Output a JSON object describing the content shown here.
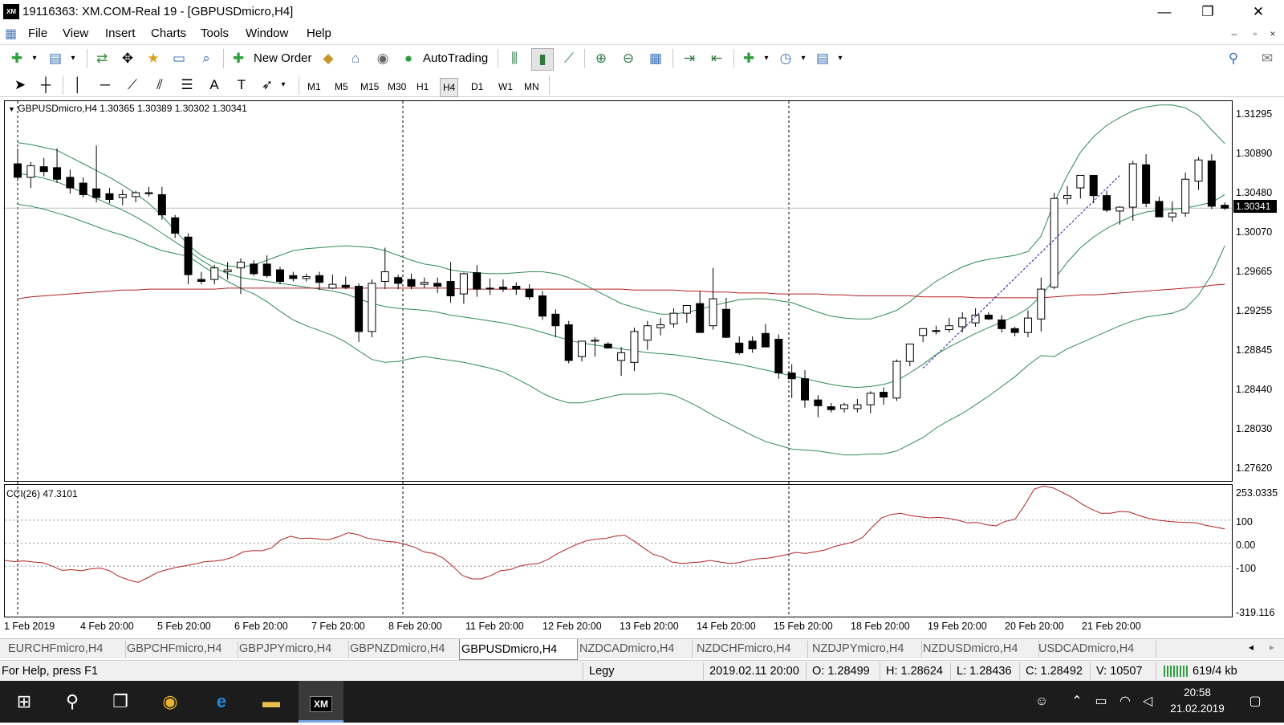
{
  "window": {
    "logo": "XM",
    "title": "19116363: XM.COM-Real 19 - [GBPUSDmicro,H4]",
    "minimize": "—",
    "maximize": "❐",
    "close": "✕"
  },
  "menu": {
    "items": [
      "File",
      "View",
      "Insert",
      "Charts",
      "Tools",
      "Window",
      "Help"
    ],
    "mdi": [
      "–",
      "▫",
      "×"
    ]
  },
  "toolbar1": {
    "new_order_label": "New Order",
    "autotrading_label": "AutoTrading"
  },
  "toolbar2": {
    "timeframes": [
      "M1",
      "M5",
      "M15",
      "M30",
      "H1",
      "H4",
      "D1",
      "W1",
      "MN"
    ],
    "active_timeframe": "H4"
  },
  "chart": {
    "info": "GBPUSDmicro,H4  1.30365 1.30389 1.30302 1.30341",
    "indicator_info": "CCI(26) 47.3101",
    "current_price": "1.30341",
    "colors": {
      "candle_bear": "#000000",
      "candle_bull": "#ffffff",
      "bands": "#2e8b57",
      "ma": "#b22222",
      "cci": "#b22222"
    }
  },
  "chart_data": {
    "type": "candlestick",
    "symbol": "GBPUSDmicro",
    "timeframe": "H4",
    "price_axis_labels": [
      "1.31295",
      "1.30890",
      "1.30480",
      "1.30070",
      "1.29665",
      "1.29255",
      "1.28845",
      "1.28440",
      "1.28030",
      "1.27620"
    ],
    "ylim": [
      1.2751,
      1.3145
    ],
    "cci_axis_labels": [
      "253.0335",
      "100",
      "0.00",
      "-100",
      "-319.116"
    ],
    "cci_ylim": [
      -319.116,
      253.0335
    ],
    "date_labels": [
      "1 Feb 2019",
      "4 Feb 20:00",
      "5 Feb 20:00",
      "6 Feb 20:00",
      "7 Feb 20:00",
      "8 Feb 20:00",
      "11 Feb 20:00",
      "12 Feb 20:00",
      "13 Feb 20:00",
      "14 Feb 20:00",
      "15 Feb 20:00",
      "18 Feb 20:00",
      "19 Feb 20:00",
      "20 Feb 20:00",
      "21 Feb 20:00"
    ],
    "candles": [
      {
        "o": 1.308,
        "h": 1.3096,
        "l": 1.3062,
        "c": 1.3066
      },
      {
        "o": 1.3066,
        "h": 1.3082,
        "l": 1.3055,
        "c": 1.3078
      },
      {
        "o": 1.3077,
        "h": 1.3086,
        "l": 1.3067,
        "c": 1.3072
      },
      {
        "o": 1.3076,
        "h": 1.3096,
        "l": 1.306,
        "c": 1.3064
      },
      {
        "o": 1.3066,
        "h": 1.3074,
        "l": 1.3049,
        "c": 1.3055
      },
      {
        "o": 1.306,
        "h": 1.3066,
        "l": 1.3045,
        "c": 1.3048
      },
      {
        "o": 1.3054,
        "h": 1.3099,
        "l": 1.304,
        "c": 1.3045
      },
      {
        "o": 1.3049,
        "h": 1.3055,
        "l": 1.3039,
        "c": 1.3043
      },
      {
        "o": 1.3045,
        "h": 1.3053,
        "l": 1.3037,
        "c": 1.3048
      },
      {
        "o": 1.3046,
        "h": 1.3052,
        "l": 1.304,
        "c": 1.305
      },
      {
        "o": 1.305,
        "h": 1.3056,
        "l": 1.3046,
        "c": 1.3049
      },
      {
        "o": 1.3048,
        "h": 1.3056,
        "l": 1.3022,
        "c": 1.3027
      },
      {
        "o": 1.3024,
        "h": 1.3027,
        "l": 1.3003,
        "c": 1.3008
      },
      {
        "o": 1.3004,
        "h": 1.3008,
        "l": 1.2955,
        "c": 1.2965
      },
      {
        "o": 1.296,
        "h": 1.2968,
        "l": 1.2955,
        "c": 1.2958
      },
      {
        "o": 1.296,
        "h": 1.2975,
        "l": 1.2955,
        "c": 1.2972
      },
      {
        "o": 1.2968,
        "h": 1.2978,
        "l": 1.296,
        "c": 1.297
      },
      {
        "o": 1.2972,
        "h": 1.2982,
        "l": 1.2945,
        "c": 1.2978
      },
      {
        "o": 1.2976,
        "h": 1.298,
        "l": 1.2964,
        "c": 1.2966
      },
      {
        "o": 1.2976,
        "h": 1.2985,
        "l": 1.2962,
        "c": 1.2964
      },
      {
        "o": 1.297,
        "h": 1.2973,
        "l": 1.2955,
        "c": 1.2958
      },
      {
        "o": 1.2964,
        "h": 1.2968,
        "l": 1.2958,
        "c": 1.2961
      },
      {
        "o": 1.2961,
        "h": 1.2966,
        "l": 1.2958,
        "c": 1.2963
      },
      {
        "o": 1.2964,
        "h": 1.2968,
        "l": 1.2949,
        "c": 1.2957
      },
      {
        "o": 1.2951,
        "h": 1.2965,
        "l": 1.295,
        "c": 1.2955
      },
      {
        "o": 1.2954,
        "h": 1.2963,
        "l": 1.295,
        "c": 1.2952
      },
      {
        "o": 1.2953,
        "h": 1.2956,
        "l": 1.2895,
        "c": 1.2906
      },
      {
        "o": 1.2906,
        "h": 1.296,
        "l": 1.29,
        "c": 1.2956
      },
      {
        "o": 1.2958,
        "h": 1.2993,
        "l": 1.295,
        "c": 1.2968
      },
      {
        "o": 1.2962,
        "h": 1.2965,
        "l": 1.295,
        "c": 1.2956
      },
      {
        "o": 1.296,
        "h": 1.2966,
        "l": 1.295,
        "c": 1.2953
      },
      {
        "o": 1.2955,
        "h": 1.2962,
        "l": 1.2951,
        "c": 1.2957
      },
      {
        "o": 1.2956,
        "h": 1.2962,
        "l": 1.2946,
        "c": 1.2953
      },
      {
        "o": 1.2958,
        "h": 1.2978,
        "l": 1.2936,
        "c": 1.2943
      },
      {
        "o": 1.2945,
        "h": 1.2967,
        "l": 1.2935,
        "c": 1.2966
      },
      {
        "o": 1.2967,
        "h": 1.2975,
        "l": 1.2942,
        "c": 1.295
      },
      {
        "o": 1.2951,
        "h": 1.2961,
        "l": 1.2944,
        "c": 1.2951
      },
      {
        "o": 1.2952,
        "h": 1.296,
        "l": 1.2947,
        "c": 1.295
      },
      {
        "o": 1.2953,
        "h": 1.2957,
        "l": 1.2944,
        "c": 1.295
      },
      {
        "o": 1.295,
        "h": 1.2955,
        "l": 1.2939,
        "c": 1.2942
      },
      {
        "o": 1.2943,
        "h": 1.2948,
        "l": 1.2918,
        "c": 1.2922
      },
      {
        "o": 1.2924,
        "h": 1.2929,
        "l": 1.29,
        "c": 1.2912
      },
      {
        "o": 1.2913,
        "h": 1.2917,
        "l": 1.2873,
        "c": 1.2876
      },
      {
        "o": 1.288,
        "h": 1.2895,
        "l": 1.2875,
        "c": 1.2896
      },
      {
        "o": 1.2896,
        "h": 1.29,
        "l": 1.288,
        "c": 1.2897
      },
      {
        "o": 1.2893,
        "h": 1.2895,
        "l": 1.2888,
        "c": 1.2889
      },
      {
        "o": 1.2876,
        "h": 1.289,
        "l": 1.286,
        "c": 1.2884
      },
      {
        "o": 1.2874,
        "h": 1.291,
        "l": 1.2865,
        "c": 1.2906
      },
      {
        "o": 1.2897,
        "h": 1.2917,
        "l": 1.2887,
        "c": 1.2912
      },
      {
        "o": 1.291,
        "h": 1.292,
        "l": 1.2902,
        "c": 1.2913
      },
      {
        "o": 1.2914,
        "h": 1.293,
        "l": 1.291,
        "c": 1.2925
      },
      {
        "o": 1.2925,
        "h": 1.2931,
        "l": 1.2915,
        "c": 1.2933
      },
      {
        "o": 1.2935,
        "h": 1.2948,
        "l": 1.2905,
        "c": 1.2905
      },
      {
        "o": 1.2912,
        "h": 1.2972,
        "l": 1.2908,
        "c": 1.294
      },
      {
        "o": 1.2929,
        "h": 1.2941,
        "l": 1.2899,
        "c": 1.29
      },
      {
        "o": 1.2894,
        "h": 1.2901,
        "l": 1.2882,
        "c": 1.2884
      },
      {
        "o": 1.2896,
        "h": 1.2901,
        "l": 1.2884,
        "c": 1.2888
      },
      {
        "o": 1.2904,
        "h": 1.2914,
        "l": 1.2896,
        "c": 1.289
      },
      {
        "o": 1.2898,
        "h": 1.2903,
        "l": 1.2857,
        "c": 1.2863
      },
      {
        "o": 1.2863,
        "h": 1.2872,
        "l": 1.2837,
        "c": 1.2857
      },
      {
        "o": 1.2857,
        "h": 1.2866,
        "l": 1.2827,
        "c": 1.2835
      },
      {
        "o": 1.2835,
        "h": 1.284,
        "l": 1.2817,
        "c": 1.2829
      },
      {
        "o": 1.2828,
        "h": 1.2832,
        "l": 1.2822,
        "c": 1.2825
      },
      {
        "o": 1.2826,
        "h": 1.2832,
        "l": 1.2822,
        "c": 1.283
      },
      {
        "o": 1.2826,
        "h": 1.2836,
        "l": 1.2822,
        "c": 1.283
      },
      {
        "o": 1.283,
        "h": 1.2844,
        "l": 1.2821,
        "c": 1.2842
      },
      {
        "o": 1.2843,
        "h": 1.2848,
        "l": 1.283,
        "c": 1.2838
      },
      {
        "o": 1.2837,
        "h": 1.2877,
        "l": 1.2834,
        "c": 1.2875
      },
      {
        "o": 1.2875,
        "h": 1.2892,
        "l": 1.287,
        "c": 1.2893
      },
      {
        "o": 1.2902,
        "h": 1.2907,
        "l": 1.2895,
        "c": 1.2909
      },
      {
        "o": 1.2907,
        "h": 1.2912,
        "l": 1.2903,
        "c": 1.2906
      },
      {
        "o": 1.2908,
        "h": 1.292,
        "l": 1.2905,
        "c": 1.2912
      },
      {
        "o": 1.2911,
        "h": 1.2926,
        "l": 1.2905,
        "c": 1.292
      },
      {
        "o": 1.2915,
        "h": 1.293,
        "l": 1.2911,
        "c": 1.2923
      },
      {
        "o": 1.2923,
        "h": 1.2926,
        "l": 1.2918,
        "c": 1.2919
      },
      {
        "o": 1.2918,
        "h": 1.2923,
        "l": 1.2905,
        "c": 1.2909
      },
      {
        "o": 1.2909,
        "h": 1.2911,
        "l": 1.2901,
        "c": 1.2905
      },
      {
        "o": 1.2905,
        "h": 1.2928,
        "l": 1.29,
        "c": 1.292
      },
      {
        "o": 1.2919,
        "h": 1.2962,
        "l": 1.2906,
        "c": 1.295
      },
      {
        "o": 1.2952,
        "h": 1.305,
        "l": 1.295,
        "c": 1.3044
      },
      {
        "o": 1.3044,
        "h": 1.3057,
        "l": 1.3038,
        "c": 1.3047
      },
      {
        "o": 1.3055,
        "h": 1.3063,
        "l": 1.3044,
        "c": 1.3068
      },
      {
        "o": 1.3068,
        "h": 1.3066,
        "l": 1.3039,
        "c": 1.3047
      },
      {
        "o": 1.3047,
        "h": 1.3052,
        "l": 1.303,
        "c": 1.3032
      },
      {
        "o": 1.3031,
        "h": 1.3036,
        "l": 1.3017,
        "c": 1.3035
      },
      {
        "o": 1.3035,
        "h": 1.3083,
        "l": 1.3021,
        "c": 1.308
      },
      {
        "o": 1.3079,
        "h": 1.309,
        "l": 1.3035,
        "c": 1.3039
      },
      {
        "o": 1.3041,
        "h": 1.3046,
        "l": 1.3028,
        "c": 1.3025
      },
      {
        "o": 1.3025,
        "h": 1.3041,
        "l": 1.302,
        "c": 1.3029
      },
      {
        "o": 1.3029,
        "h": 1.3071,
        "l": 1.3025,
        "c": 1.3064
      },
      {
        "o": 1.3062,
        "h": 1.3087,
        "l": 1.3053,
        "c": 1.3084
      },
      {
        "o": 1.3083,
        "h": 1.309,
        "l": 1.3033,
        "c": 1.3036
      },
      {
        "o": 1.3037,
        "h": 1.304,
        "l": 1.3032,
        "c": 1.3034
      }
    ],
    "upper_band": [
      1.3102,
      1.31,
      1.3097,
      1.3094,
      1.3087,
      1.308,
      1.3073,
      1.3066,
      1.3058,
      1.3049,
      1.3039,
      1.3026,
      1.3011,
      1.2996,
      1.2985,
      1.2978,
      1.2974,
      1.2973,
      1.2975,
      1.298,
      1.2985,
      1.299,
      1.2992,
      1.2993,
      1.2994,
      1.2995,
      1.2994,
      1.2993,
      1.299,
      1.2985,
      1.298,
      1.2976,
      1.2974,
      1.297,
      1.2968,
      1.2967,
      1.2966,
      1.2966,
      1.2967,
      1.2968,
      1.2968,
      1.2966,
      1.2962,
      1.2956,
      1.2949,
      1.2942,
      1.2935,
      1.2931,
      1.2927,
      1.2924,
      1.2924,
      1.2926,
      1.2929,
      1.2933,
      1.2936,
      1.2939,
      1.294,
      1.294,
      1.2938,
      1.2936,
      1.2931,
      1.2926,
      1.2922,
      1.292,
      1.2919,
      1.2919,
      1.2923,
      1.2928,
      1.2937,
      1.2948,
      1.2958,
      1.2966,
      1.2973,
      1.2978,
      1.2981,
      1.2983,
      1.2985,
      1.2989,
      1.3005,
      1.304,
      1.3068,
      1.3092,
      1.3108,
      1.312,
      1.3128,
      1.3135,
      1.3139,
      1.3141,
      1.3141,
      1.3138,
      1.313,
      1.3115,
      1.3101
    ],
    "middle_band": [
      1.307,
      1.3068,
      1.3065,
      1.3061,
      1.3056,
      1.305,
      1.3044,
      1.3038,
      1.3032,
      1.3025,
      1.3017,
      1.3008,
      1.2999,
      1.299,
      1.298,
      1.2972,
      1.2966,
      1.2962,
      1.296,
      1.2958,
      1.2956,
      1.2954,
      1.2952,
      1.295,
      1.2948,
      1.2945,
      1.294,
      1.2935,
      1.2932,
      1.293,
      1.2929,
      1.2928,
      1.2926,
      1.2923,
      1.2921,
      1.2919,
      1.2917,
      1.2915,
      1.2912,
      1.2909,
      1.2905,
      1.2901,
      1.2897,
      1.2894,
      1.2892,
      1.289,
      1.2888,
      1.2886,
      1.2884,
      1.2883,
      1.2882,
      1.288,
      1.2878,
      1.2876,
      1.2874,
      1.2872,
      1.2869,
      1.2866,
      1.2863,
      1.286,
      1.2857,
      1.2854,
      1.2851,
      1.2849,
      1.2848,
      1.2849,
      1.2851,
      1.2855,
      1.2863,
      1.2872,
      1.2882,
      1.289,
      1.2897,
      1.2904,
      1.291,
      1.2916,
      1.2922,
      1.293,
      1.2943,
      1.296,
      1.2978,
      1.2993,
      1.3004,
      1.3013,
      1.302,
      1.3026,
      1.303,
      1.3032,
      1.3033,
      1.3034,
      1.3037,
      1.304,
      1.3048
    ],
    "lower_band": [
      1.3038,
      1.3036,
      1.3033,
      1.3029,
      1.3025,
      1.302,
      1.3015,
      1.301,
      1.3006,
      1.3001,
      1.2995,
      1.299,
      1.2987,
      1.2984,
      1.2975,
      1.2966,
      1.2958,
      1.2951,
      1.2945,
      1.2937,
      1.2927,
      1.2918,
      1.2912,
      1.2907,
      1.2902,
      1.2895,
      1.2886,
      1.2877,
      1.2874,
      1.2875,
      1.2878,
      1.288,
      1.2878,
      1.2876,
      1.2874,
      1.2871,
      1.2868,
      1.2864,
      1.2857,
      1.285,
      1.2842,
      1.2836,
      1.2832,
      1.2832,
      1.2835,
      1.2838,
      1.2841,
      1.2841,
      1.2841,
      1.2842,
      1.284,
      1.2834,
      1.2827,
      1.2819,
      1.2812,
      1.2805,
      1.2798,
      1.2792,
      1.2788,
      1.2784,
      1.2783,
      1.2782,
      1.278,
      1.2778,
      1.2778,
      1.2779,
      1.2779,
      1.2782,
      1.2789,
      1.2796,
      1.2806,
      1.2814,
      1.2821,
      1.283,
      1.2839,
      1.2849,
      1.2859,
      1.2871,
      1.2881,
      1.288,
      1.2888,
      1.2894,
      1.29,
      1.2906,
      1.2912,
      1.2917,
      1.2921,
      1.2923,
      1.2925,
      1.293,
      1.2944,
      1.2965,
      1.2995
    ],
    "moving_average": [
      1.294,
      1.2942,
      1.2943,
      1.2944,
      1.2945,
      1.2946,
      1.2947,
      1.2948,
      1.2949,
      1.2949,
      1.295,
      1.295,
      1.295,
      1.295,
      1.295,
      1.295,
      1.2951,
      1.2951,
      1.2951,
      1.2951,
      1.2951,
      1.2951,
      1.2951,
      1.2951,
      1.2951,
      1.2951,
      1.2951,
      1.2951,
      1.2951,
      1.2951,
      1.2951,
      1.2951,
      1.2951,
      1.2951,
      1.295,
      1.295,
      1.295,
      1.295,
      1.295,
      1.295,
      1.295,
      1.295,
      1.295,
      1.295,
      1.295,
      1.295,
      1.295,
      1.2949,
      1.2949,
      1.2949,
      1.2949,
      1.2948,
      1.2948,
      1.2947,
      1.2947,
      1.2946,
      1.2946,
      1.2946,
      1.2945,
      1.2945,
      1.2945,
      1.2945,
      1.2944,
      1.2944,
      1.2943,
      1.2943,
      1.2943,
      1.2943,
      1.2943,
      1.2942,
      1.2942,
      1.2942,
      1.2942,
      1.2941,
      1.2941,
      1.2941,
      1.2941,
      1.2941,
      1.2941,
      1.2942,
      1.2943,
      1.2944,
      1.2944,
      1.2945,
      1.2946,
      1.2947,
      1.2948,
      1.2949,
      1.295,
      1.2951,
      1.2952,
      1.2954,
      1.2955
    ],
    "cci": [
      -75,
      -80,
      -77,
      -82,
      -85,
      -100,
      -118,
      -115,
      -120,
      -112,
      -108,
      -120,
      -145,
      -160,
      -170,
      -150,
      -128,
      -115,
      -105,
      -98,
      -90,
      -80,
      -78,
      -72,
      -60,
      -38,
      -32,
      -33,
      -20,
      15,
      30,
      20,
      22,
      18,
      15,
      28,
      45,
      38,
      22,
      15,
      8,
      5,
      -5,
      -18,
      -38,
      -45,
      -65,
      -100,
      -140,
      -155,
      -155,
      -140,
      -120,
      -115,
      -100,
      -92,
      -88,
      -70,
      -45,
      -25,
      -5,
      10,
      18,
      20,
      30,
      35,
      10,
      -20,
      -48,
      -60,
      -82,
      -88,
      -85,
      -82,
      -75,
      -82,
      -88,
      -85,
      -75,
      -68,
      -65,
      -58,
      -50,
      -40,
      -45,
      -38,
      -30,
      -15,
      -5,
      5,
      25,
      70,
      110,
      125,
      130,
      120,
      115,
      110,
      112,
      108,
      100,
      88,
      90,
      80,
      75,
      95,
      104,
      165,
      235,
      248,
      240,
      220,
      198,
      170,
      148,
      130,
      130,
      138,
      135,
      120,
      108,
      100,
      95,
      92,
      90,
      88,
      78,
      70,
      62
    ],
    "hline_price": 1.3034,
    "trendline": {
      "from_index": 69,
      "from_price": 1.2868,
      "to_index": 84,
      "to_price": 1.3068
    },
    "period_separators": [
      1,
      31,
      61
    ]
  },
  "axes": {
    "price_labels": [
      "1.31295",
      "1.30890",
      "1.30480",
      "1.30070",
      "1.29665",
      "1.29255",
      "1.28845",
      "1.28440",
      "1.28030",
      "1.27620"
    ],
    "cci_labels": [
      "253.0335",
      "100",
      "0.00",
      "-100",
      "-319.116"
    ],
    "date_labels": [
      "1 Feb 2019",
      "4 Feb 20:00",
      "5 Feb 20:00",
      "6 Feb 20:00",
      "7 Feb 20:00",
      "8 Feb 20:00",
      "11 Feb 20:00",
      "12 Feb 20:00",
      "13 Feb 20:00",
      "14 Feb 20:00",
      "15 Feb 20:00",
      "18 Feb 20:00",
      "19 Feb 20:00",
      "20 Feb 20:00",
      "21 Feb 20:00"
    ]
  },
  "tabs": {
    "items": [
      "EURCHFmicro,H4",
      "GBPCHFmicro,H4",
      "GBPJPYmicro,H4",
      "GBPNZDmicro,H4",
      "GBPUSDmicro,H4",
      "NZDCADmicro,H4",
      "NZDCHFmicro,H4",
      "NZDJPYmicro,H4",
      "NZDUSDmicro,H4",
      "USDCADmicro,H4"
    ],
    "active": "GBPUSDmicro,H4",
    "scroll_left": "◂",
    "scroll_right": "▸"
  },
  "status": {
    "help": "For Help, press F1",
    "profile": "Legy",
    "datetime": "2019.02.11 20:00",
    "open": "O: 1.28499",
    "high": "H: 1.28624",
    "low": "L: 1.28436",
    "close": "C: 1.28492",
    "volume": "V: 10507",
    "traffic": "619/4 kb"
  },
  "taskbar": {
    "time": "20:58",
    "date": "21.02.2019",
    "xm_label": "XM"
  }
}
